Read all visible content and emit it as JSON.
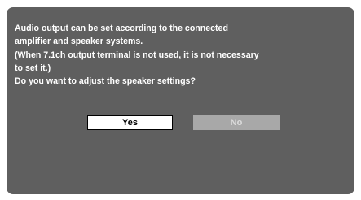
{
  "dialog": {
    "message_lines": [
      "Audio output can be set according to the connected",
      "amplifier and speaker systems.",
      "(When 7.1ch output terminal is not used, it is not necessary",
      "to set it.)",
      "Do you want to adjust the speaker settings?"
    ],
    "buttons": {
      "yes_label": "Yes",
      "no_label": "No"
    }
  },
  "colors": {
    "dialog_background": "#5f5f5f",
    "text": "#ffffff",
    "selected_button": "#ffffff",
    "unselected_button": "#a8a8a8"
  }
}
